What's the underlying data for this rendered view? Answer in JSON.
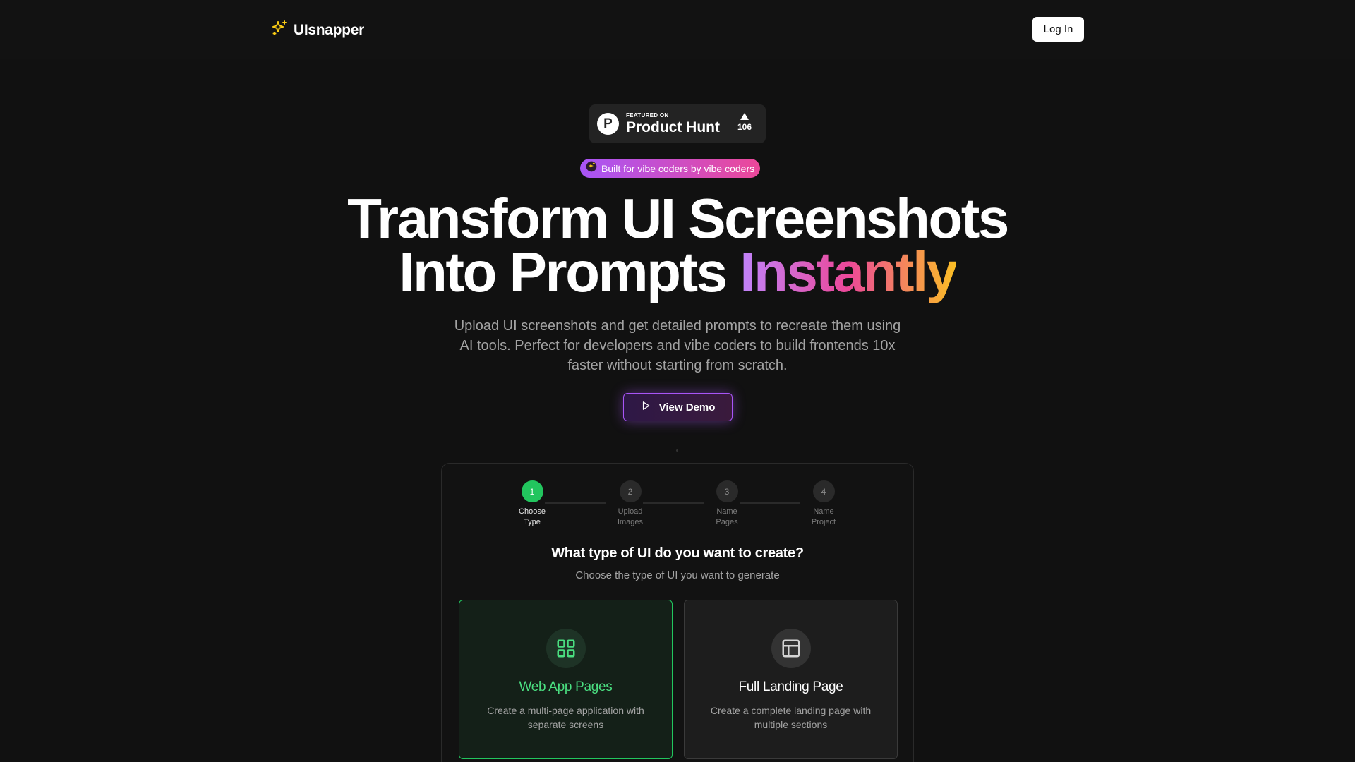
{
  "nav": {
    "brand": "UIsnapper",
    "login_label": "Log In"
  },
  "product_hunt": {
    "featured": "FEATURED ON",
    "name": "Product Hunt",
    "logo_letter": "P",
    "votes": "106"
  },
  "pill": {
    "text": "Built for vibe coders by vibe coders"
  },
  "hero": {
    "line1": "Transform UI Screenshots",
    "line2_plain": "Into Prompts ",
    "line2_gradient": "Instantly",
    "subtitle": "Upload UI screenshots and get detailed prompts to recreate them using AI tools. Perfect for developers and vibe coders to build frontends 10x faster without starting from scratch.",
    "demo_label": "View Demo"
  },
  "wizard": {
    "steps": [
      {
        "number": "1",
        "label": "Choose Type",
        "active": true
      },
      {
        "number": "2",
        "label": "Upload Images",
        "active": false
      },
      {
        "number": "3",
        "label": "Name Pages",
        "active": false
      },
      {
        "number": "4",
        "label": "Name Project",
        "active": false
      }
    ],
    "question": "What type of UI do you want to create?",
    "question_sub": "Choose the type of UI you want to generate",
    "options": [
      {
        "title": "Web App Pages",
        "description": "Create a multi-page application with separate screens",
        "icon": "grid-icon",
        "selected": true
      },
      {
        "title": "Full Landing Page",
        "description": "Create a complete landing page with multiple sections",
        "icon": "layout-icon",
        "selected": false
      }
    ]
  },
  "colors": {
    "background": "#111111",
    "accent_green": "#22c55e",
    "accent_purple": "#a855f7",
    "accent_pink": "#ec4899",
    "accent_yellow": "#fbbf24"
  }
}
